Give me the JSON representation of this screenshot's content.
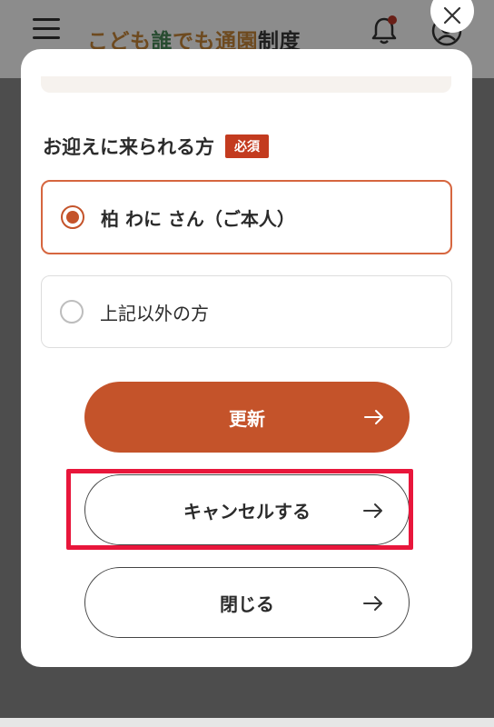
{
  "header": {
    "logo_part1": "こども",
    "logo_part2": "誰",
    "logo_part3": "でも通園",
    "logo_part4": "制度",
    "icons": [
      "hamburger-menu-icon",
      "bell-icon",
      "user-icon"
    ],
    "notification_dot_color": "#c0392b"
  },
  "modal": {
    "section_label": "お迎えに来られる方",
    "required_badge": "必須",
    "options": [
      {
        "label": "柏 わに さん（ご本人）",
        "selected": true
      },
      {
        "label": "上記以外の方",
        "selected": false
      }
    ],
    "buttons": {
      "update": "更新",
      "cancel": "キャンセルする",
      "close": "閉じる"
    }
  },
  "colors": {
    "accent": "#c4532a",
    "required": "#c33b1f",
    "highlight": "#e8163b"
  }
}
